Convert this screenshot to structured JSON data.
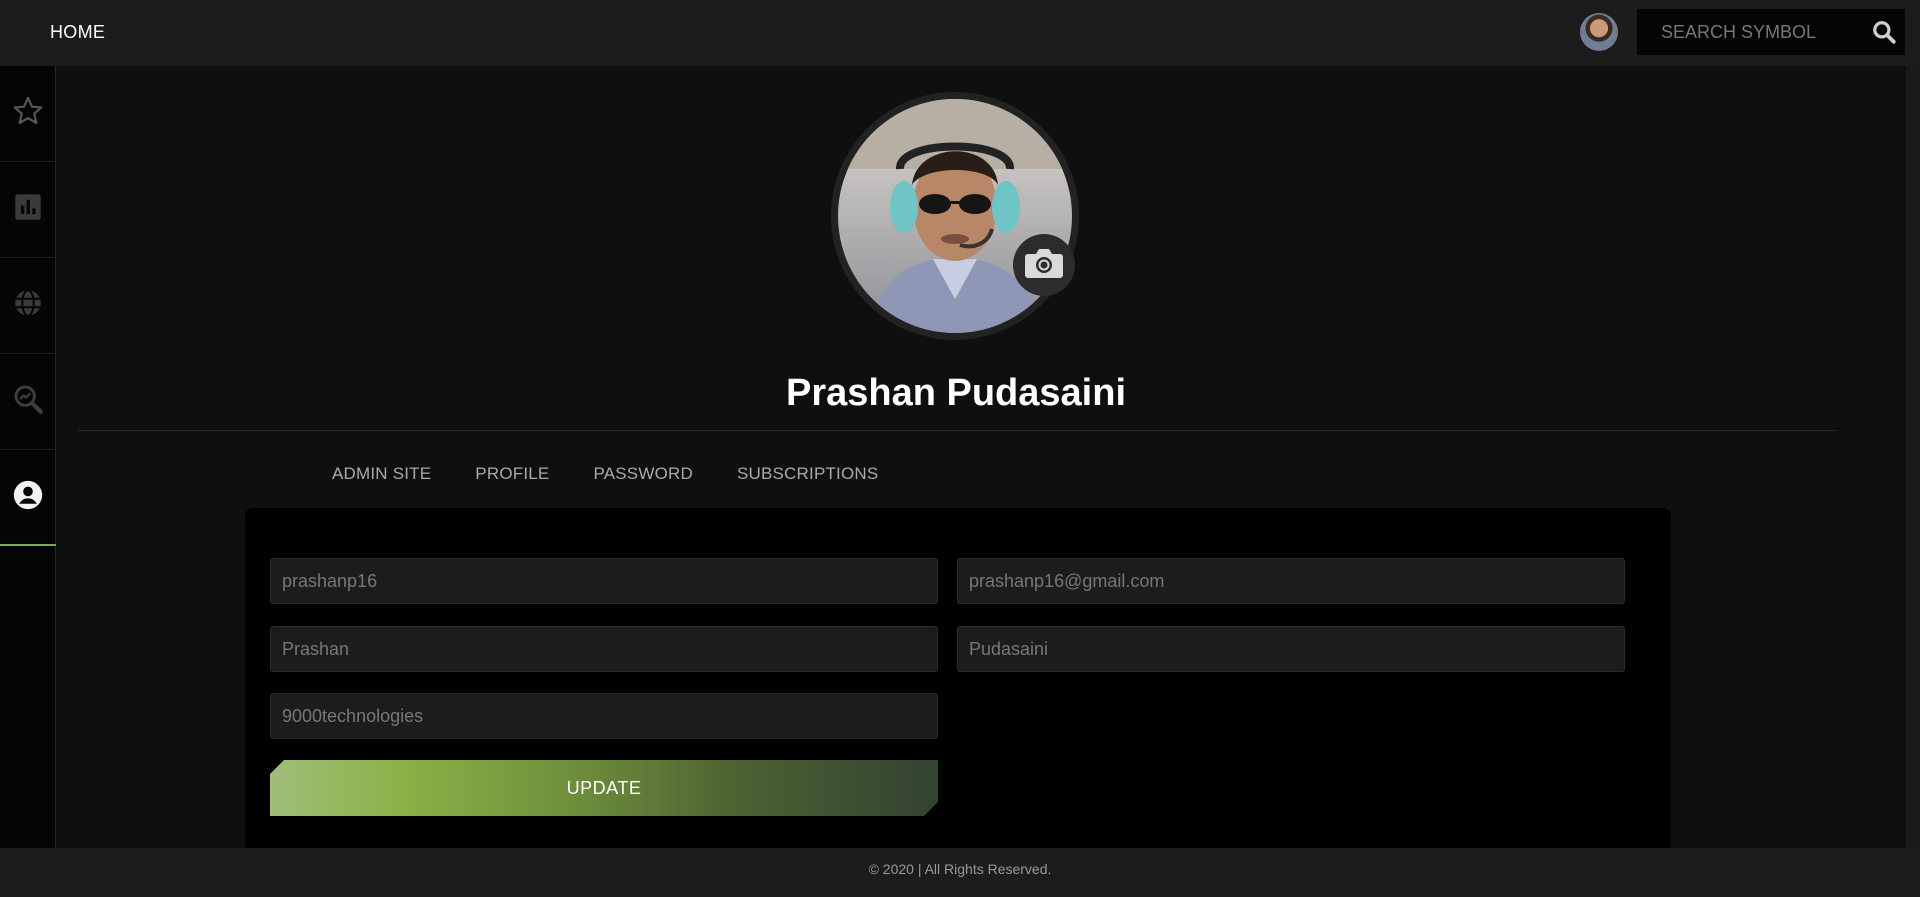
{
  "topbar": {
    "home_label": "HOME",
    "search_placeholder": "SEARCH SYMBOL",
    "search_icon": "search-icon"
  },
  "sidebar": {
    "items": [
      {
        "icon": "star-icon",
        "active": false
      },
      {
        "icon": "bar-chart-icon",
        "active": false
      },
      {
        "icon": "globe-icon",
        "active": false
      },
      {
        "icon": "search-chart-icon",
        "active": false
      },
      {
        "icon": "account-icon",
        "active": true
      }
    ]
  },
  "profile": {
    "name": "Prashan Pudasaini",
    "camera_icon": "camera-icon"
  },
  "tabs": [
    {
      "label": "ADMIN SITE"
    },
    {
      "label": "PROFILE"
    },
    {
      "label": "PASSWORD"
    },
    {
      "label": "SUBSCRIPTIONS"
    }
  ],
  "form": {
    "username_placeholder": "prashanp16",
    "email_placeholder": "prashanp16@gmail.com",
    "first_name_placeholder": "Prashan",
    "last_name_placeholder": "Pudasaini",
    "company_placeholder": "9000technologies",
    "update_label": "UPDATE"
  },
  "footer": {
    "text": "© 2020 | All Rights Reserved."
  },
  "colors": {
    "accent_green": "#8db046",
    "background": "#0f0f0f",
    "card": "#000000"
  }
}
